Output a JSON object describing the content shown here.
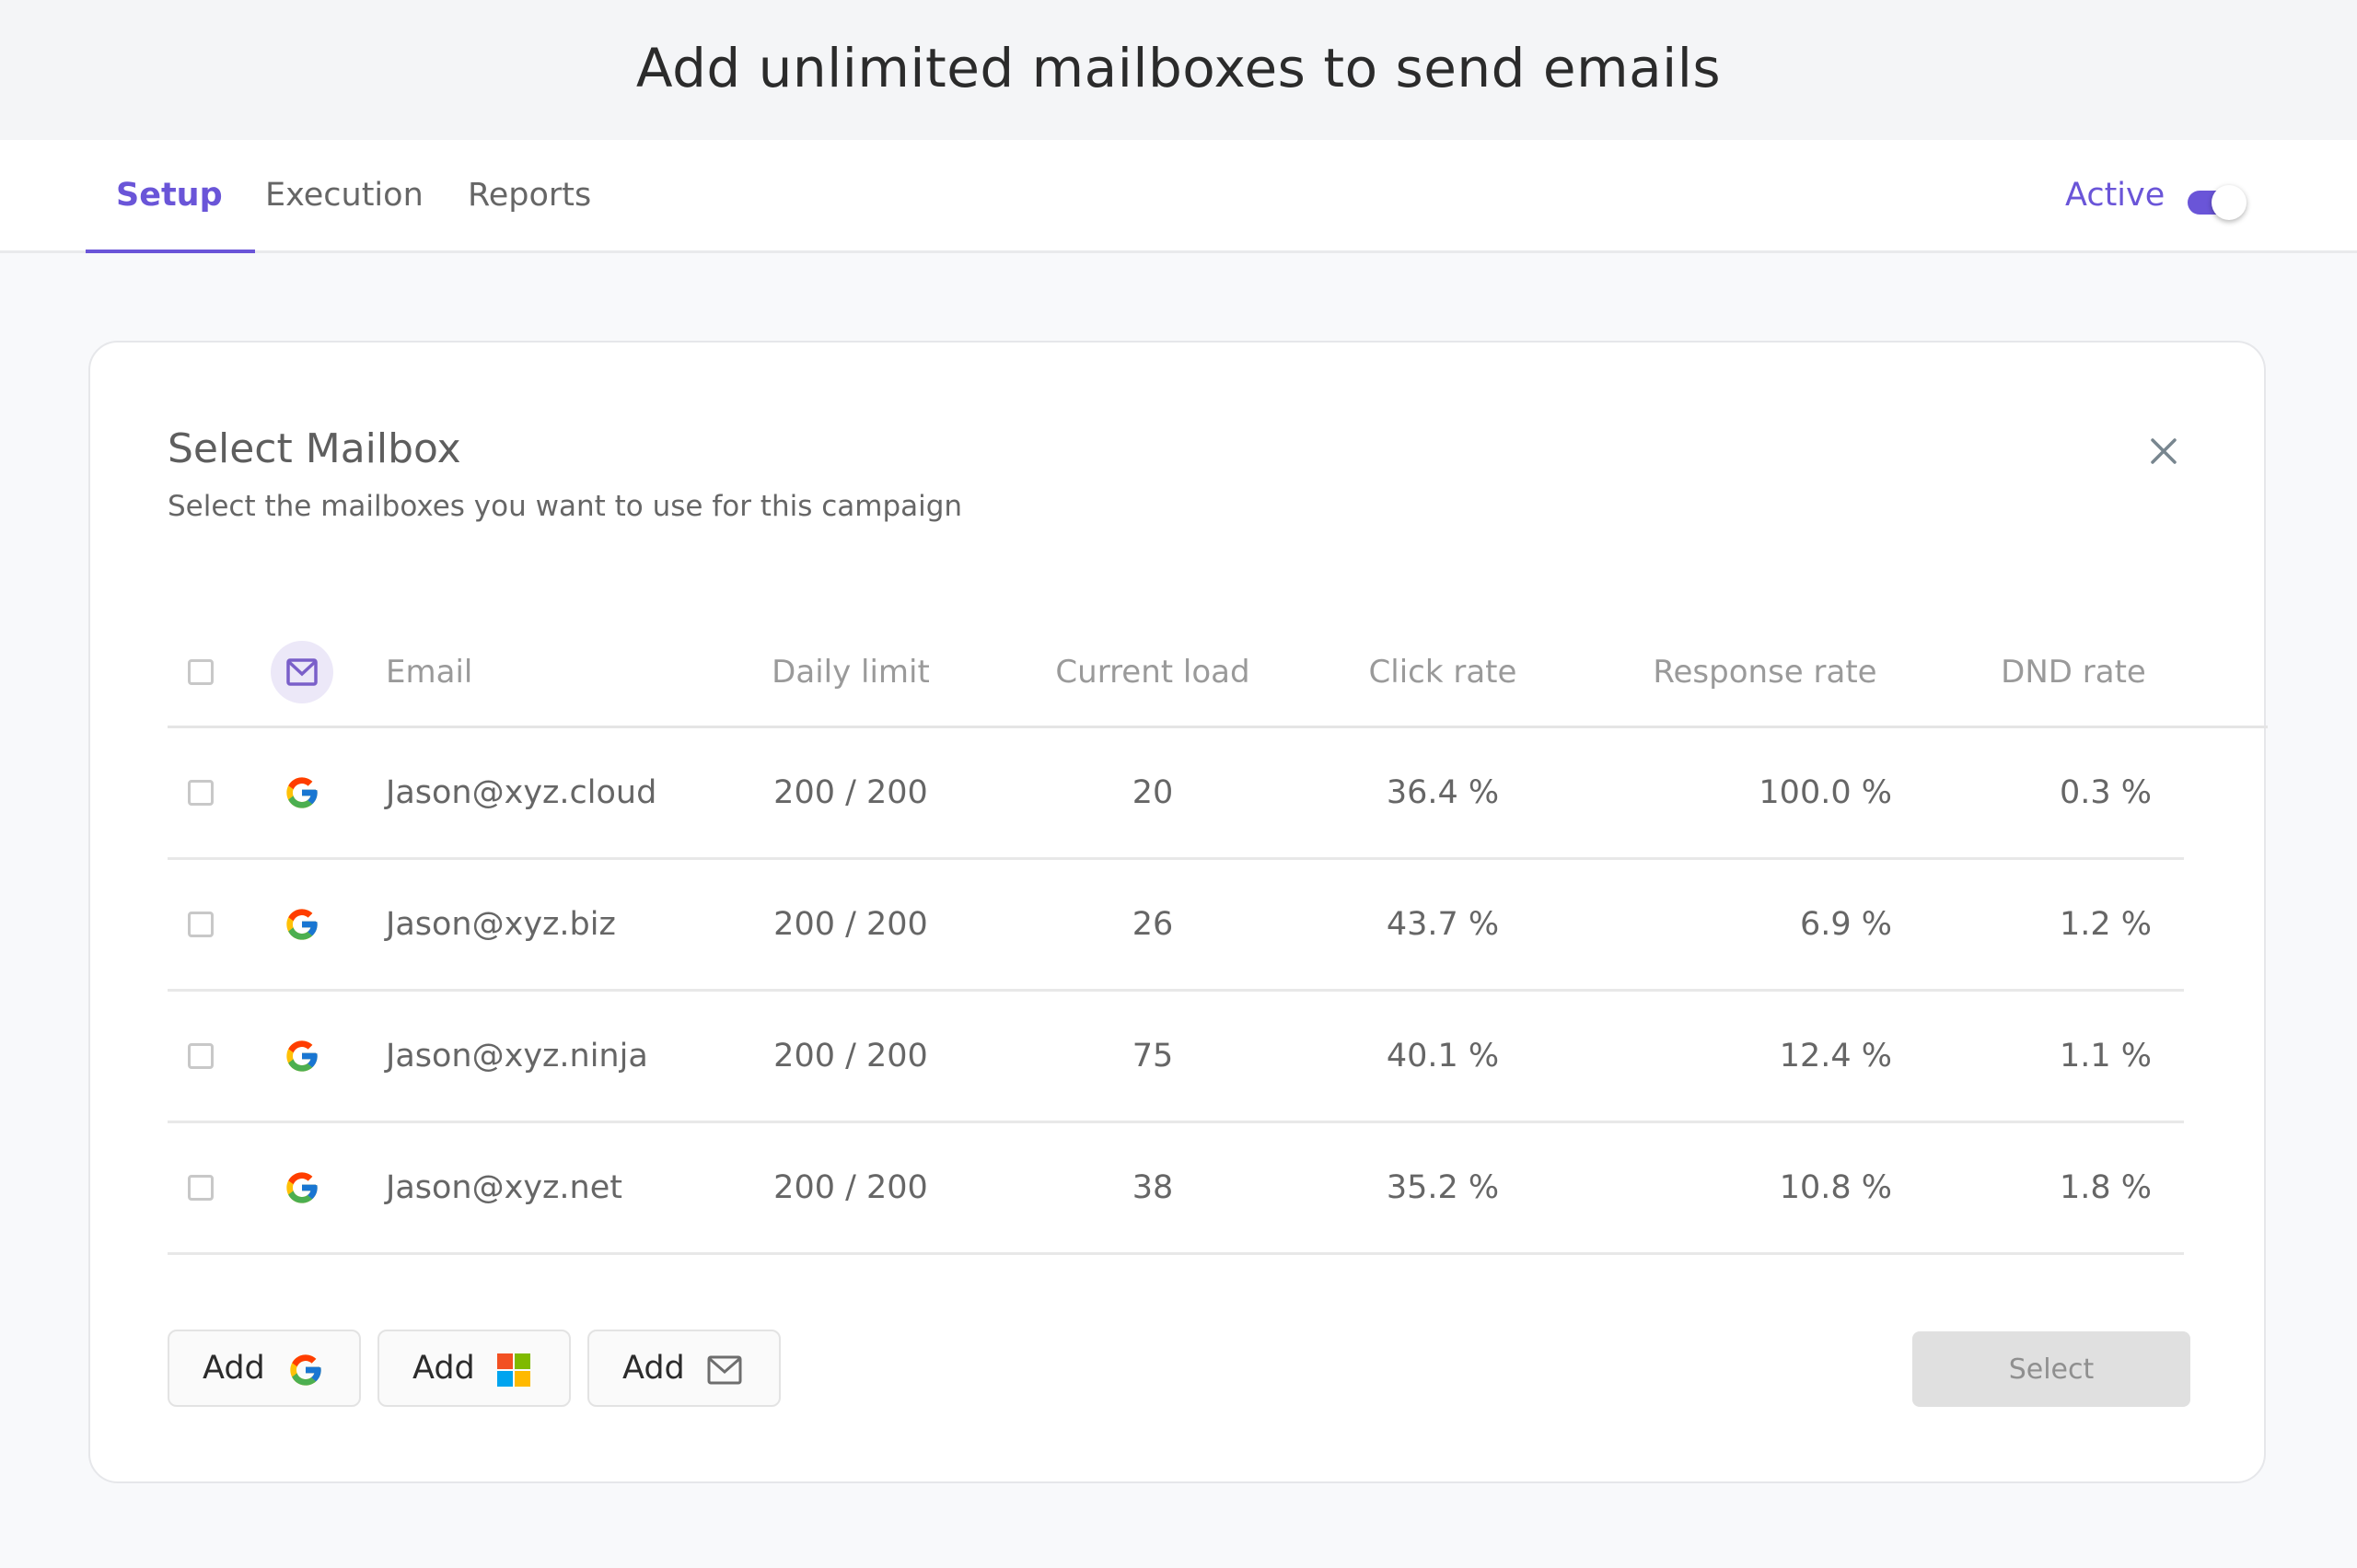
{
  "banner": {
    "title": "Add unlimited mailboxes to send emails"
  },
  "tabs": [
    {
      "label": "Setup",
      "active": true
    },
    {
      "label": "Execution",
      "active": false
    },
    {
      "label": "Reports",
      "active": false
    }
  ],
  "status": {
    "label": "Active",
    "toggle_on": true
  },
  "colors": {
    "accent": "#6a55d8",
    "disabled_bg": "#e0e0e0"
  },
  "modal": {
    "title": "Select Mailbox",
    "subtitle": "Select the mailboxes you want to use for this campaign",
    "close_icon": "close-icon",
    "columns": [
      "Email",
      "Daily limit",
      "Current load",
      "Click rate",
      "Response rate",
      "DND rate"
    ],
    "rows": [
      {
        "provider": "google",
        "email": "Jason@xyz.cloud",
        "daily_limit": "200 / 200",
        "current_load": "20",
        "click_rate": "36.4 %",
        "response_rate": "100.0 %",
        "dnd_rate": "0.3 %"
      },
      {
        "provider": "google",
        "email": "Jason@xyz.biz",
        "daily_limit": "200 / 200",
        "current_load": "26",
        "click_rate": "43.7 %",
        "response_rate": "6.9 %",
        "dnd_rate": "1.2 %"
      },
      {
        "provider": "google",
        "email": "Jason@xyz.ninja",
        "daily_limit": "200 / 200",
        "current_load": "75",
        "click_rate": "40.1 %",
        "response_rate": "12.4 %",
        "dnd_rate": "1.1 %"
      },
      {
        "provider": "google",
        "email": "Jason@xyz.net",
        "daily_limit": "200 / 200",
        "current_load": "38",
        "click_rate": "35.2 %",
        "response_rate": "10.8 %",
        "dnd_rate": "1.8 %"
      }
    ],
    "add_buttons": [
      {
        "label": "Add",
        "icon": "google-icon"
      },
      {
        "label": "Add",
        "icon": "microsoft-icon"
      },
      {
        "label": "Add",
        "icon": "mail-icon"
      }
    ],
    "select_label": "Select",
    "select_disabled": true
  }
}
